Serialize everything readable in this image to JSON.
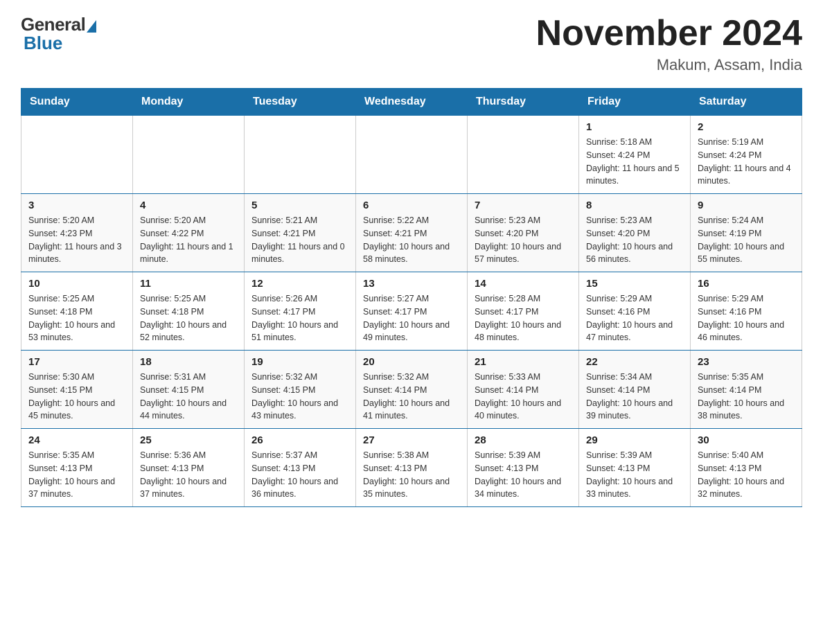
{
  "header": {
    "logo": {
      "general": "General",
      "blue": "Blue"
    },
    "title": "November 2024",
    "location": "Makum, Assam, India"
  },
  "days_of_week": [
    "Sunday",
    "Monday",
    "Tuesday",
    "Wednesday",
    "Thursday",
    "Friday",
    "Saturday"
  ],
  "weeks": [
    [
      {
        "day": "",
        "info": ""
      },
      {
        "day": "",
        "info": ""
      },
      {
        "day": "",
        "info": ""
      },
      {
        "day": "",
        "info": ""
      },
      {
        "day": "",
        "info": ""
      },
      {
        "day": "1",
        "info": "Sunrise: 5:18 AM\nSunset: 4:24 PM\nDaylight: 11 hours and 5 minutes."
      },
      {
        "day": "2",
        "info": "Sunrise: 5:19 AM\nSunset: 4:24 PM\nDaylight: 11 hours and 4 minutes."
      }
    ],
    [
      {
        "day": "3",
        "info": "Sunrise: 5:20 AM\nSunset: 4:23 PM\nDaylight: 11 hours and 3 minutes."
      },
      {
        "day": "4",
        "info": "Sunrise: 5:20 AM\nSunset: 4:22 PM\nDaylight: 11 hours and 1 minute."
      },
      {
        "day": "5",
        "info": "Sunrise: 5:21 AM\nSunset: 4:21 PM\nDaylight: 11 hours and 0 minutes."
      },
      {
        "day": "6",
        "info": "Sunrise: 5:22 AM\nSunset: 4:21 PM\nDaylight: 10 hours and 58 minutes."
      },
      {
        "day": "7",
        "info": "Sunrise: 5:23 AM\nSunset: 4:20 PM\nDaylight: 10 hours and 57 minutes."
      },
      {
        "day": "8",
        "info": "Sunrise: 5:23 AM\nSunset: 4:20 PM\nDaylight: 10 hours and 56 minutes."
      },
      {
        "day": "9",
        "info": "Sunrise: 5:24 AM\nSunset: 4:19 PM\nDaylight: 10 hours and 55 minutes."
      }
    ],
    [
      {
        "day": "10",
        "info": "Sunrise: 5:25 AM\nSunset: 4:18 PM\nDaylight: 10 hours and 53 minutes."
      },
      {
        "day": "11",
        "info": "Sunrise: 5:25 AM\nSunset: 4:18 PM\nDaylight: 10 hours and 52 minutes."
      },
      {
        "day": "12",
        "info": "Sunrise: 5:26 AM\nSunset: 4:17 PM\nDaylight: 10 hours and 51 minutes."
      },
      {
        "day": "13",
        "info": "Sunrise: 5:27 AM\nSunset: 4:17 PM\nDaylight: 10 hours and 49 minutes."
      },
      {
        "day": "14",
        "info": "Sunrise: 5:28 AM\nSunset: 4:17 PM\nDaylight: 10 hours and 48 minutes."
      },
      {
        "day": "15",
        "info": "Sunrise: 5:29 AM\nSunset: 4:16 PM\nDaylight: 10 hours and 47 minutes."
      },
      {
        "day": "16",
        "info": "Sunrise: 5:29 AM\nSunset: 4:16 PM\nDaylight: 10 hours and 46 minutes."
      }
    ],
    [
      {
        "day": "17",
        "info": "Sunrise: 5:30 AM\nSunset: 4:15 PM\nDaylight: 10 hours and 45 minutes."
      },
      {
        "day": "18",
        "info": "Sunrise: 5:31 AM\nSunset: 4:15 PM\nDaylight: 10 hours and 44 minutes."
      },
      {
        "day": "19",
        "info": "Sunrise: 5:32 AM\nSunset: 4:15 PM\nDaylight: 10 hours and 43 minutes."
      },
      {
        "day": "20",
        "info": "Sunrise: 5:32 AM\nSunset: 4:14 PM\nDaylight: 10 hours and 41 minutes."
      },
      {
        "day": "21",
        "info": "Sunrise: 5:33 AM\nSunset: 4:14 PM\nDaylight: 10 hours and 40 minutes."
      },
      {
        "day": "22",
        "info": "Sunrise: 5:34 AM\nSunset: 4:14 PM\nDaylight: 10 hours and 39 minutes."
      },
      {
        "day": "23",
        "info": "Sunrise: 5:35 AM\nSunset: 4:14 PM\nDaylight: 10 hours and 38 minutes."
      }
    ],
    [
      {
        "day": "24",
        "info": "Sunrise: 5:35 AM\nSunset: 4:13 PM\nDaylight: 10 hours and 37 minutes."
      },
      {
        "day": "25",
        "info": "Sunrise: 5:36 AM\nSunset: 4:13 PM\nDaylight: 10 hours and 37 minutes."
      },
      {
        "day": "26",
        "info": "Sunrise: 5:37 AM\nSunset: 4:13 PM\nDaylight: 10 hours and 36 minutes."
      },
      {
        "day": "27",
        "info": "Sunrise: 5:38 AM\nSunset: 4:13 PM\nDaylight: 10 hours and 35 minutes."
      },
      {
        "day": "28",
        "info": "Sunrise: 5:39 AM\nSunset: 4:13 PM\nDaylight: 10 hours and 34 minutes."
      },
      {
        "day": "29",
        "info": "Sunrise: 5:39 AM\nSunset: 4:13 PM\nDaylight: 10 hours and 33 minutes."
      },
      {
        "day": "30",
        "info": "Sunrise: 5:40 AM\nSunset: 4:13 PM\nDaylight: 10 hours and 32 minutes."
      }
    ]
  ]
}
